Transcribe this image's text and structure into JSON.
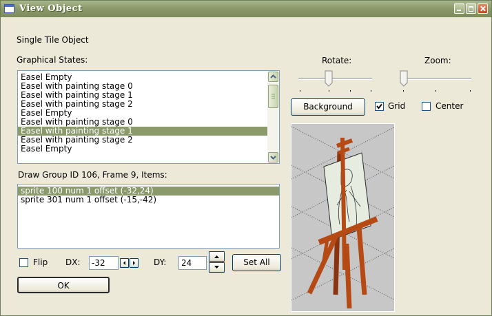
{
  "window": {
    "title": "View Object"
  },
  "object_type": "Single Tile Object",
  "graphical_states": {
    "label": "Graphical States:",
    "items": [
      "Easel Empty",
      "Easel with painting stage 0",
      "Easel with painting stage 1",
      "Easel with painting stage 2",
      "Easel Empty",
      "Easel with painting stage 0",
      "Easel with painting stage 1",
      "Easel with painting stage 2",
      "Easel Empty"
    ],
    "selected_index": 6
  },
  "draw_group": {
    "label": "Draw Group ID 106, Frame 9, Items:",
    "items": [
      "sprite 100 num 1 offset (-32,24)",
      "sprite 301 num 1 offset (-15,-42)"
    ],
    "selected_index": 0
  },
  "controls": {
    "flip_label": "Flip",
    "dx_label": "DX:",
    "dx_value": "-32",
    "dy_label": "DY:",
    "dy_value": "24",
    "set_all_label": "Set All",
    "ok_label": "OK"
  },
  "view": {
    "rotate_label": "Rotate:",
    "zoom_label": "Zoom:",
    "background_label": "Background",
    "grid_label": "Grid",
    "grid_checked": true,
    "center_label": "Center",
    "center_checked": false
  },
  "colors": {
    "titlebar": "#8c9a6c",
    "selection": "#8a9a6b",
    "preview_bg": "#c7c7c7",
    "easel_wood": "#b54a14"
  }
}
